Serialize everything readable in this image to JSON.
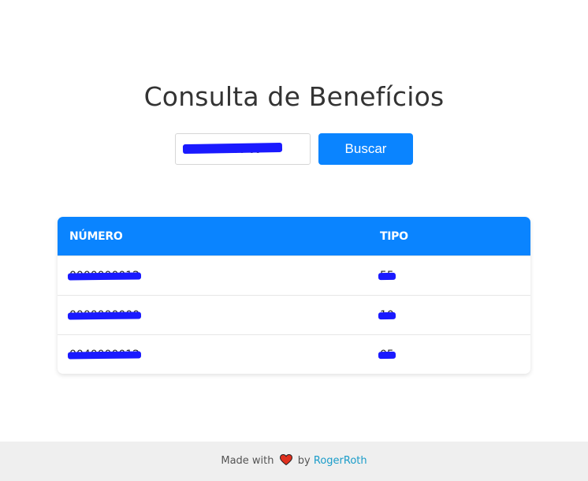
{
  "page": {
    "title": "Consulta de Benefícios"
  },
  "search": {
    "value": "000.000.000-00",
    "button_label": "Buscar"
  },
  "table": {
    "headers": [
      "NÚMERO",
      "TIPO"
    ],
    "rows": [
      {
        "numero": "0000000012",
        "tipo": "55"
      },
      {
        "numero": "0000000000",
        "tipo": "10"
      },
      {
        "numero": "0040000012",
        "tipo": "05"
      }
    ]
  },
  "footer": {
    "made_with": "Made with",
    "by": "by",
    "author": "RogerRoth"
  },
  "colors": {
    "accent": "#0a84ff",
    "heart": "#e0301e",
    "link": "#1a9cc9",
    "redaction": "#1a1aff"
  }
}
